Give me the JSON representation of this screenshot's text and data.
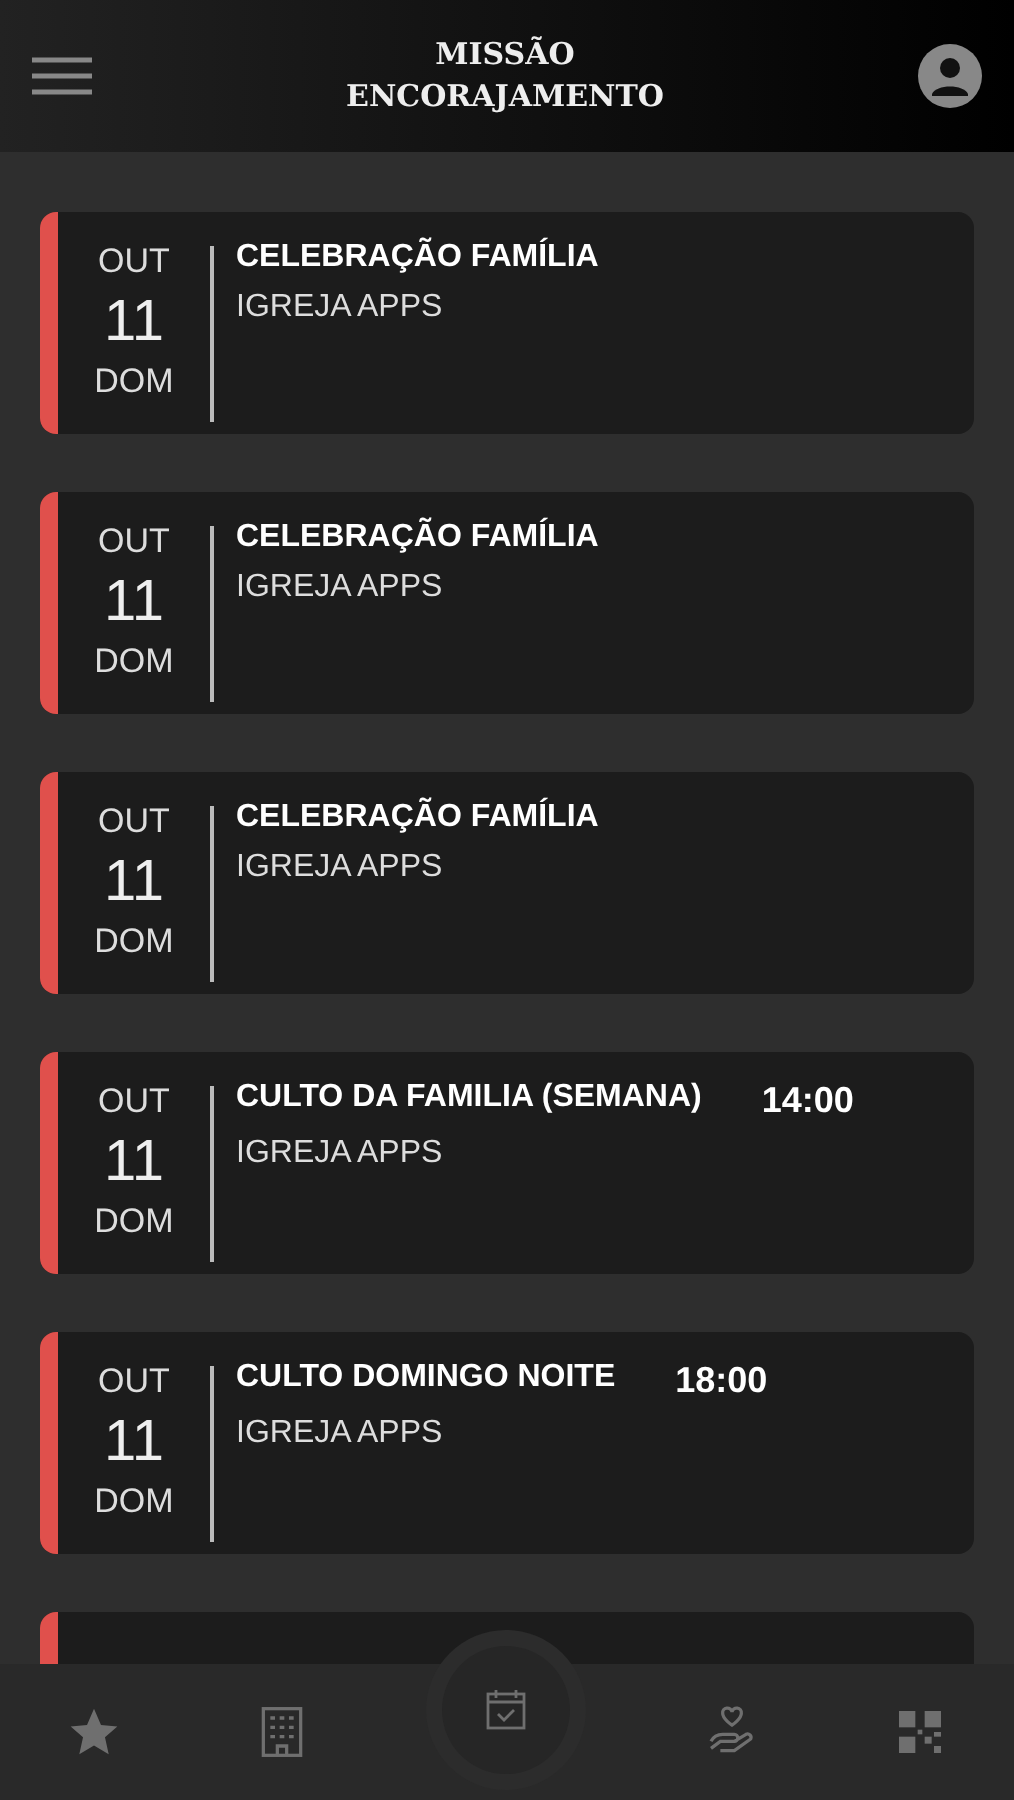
{
  "header": {
    "title_line_1": "MISSÃO",
    "title_line_2": "ENCORAJAMENTO"
  },
  "events": [
    {
      "month": "OUT",
      "day": "11",
      "weekday": "DOM",
      "title": "CELEBRAÇÃO FAMÍLIA",
      "organizer": "IGREJA APPS",
      "color": "#e0504c"
    },
    {
      "month": "OUT",
      "day": "11",
      "weekday": "DOM",
      "title": "CELEBRAÇÃO FAMÍLIA",
      "organizer": "IGREJA APPS",
      "color": "#e0504c"
    },
    {
      "month": "OUT",
      "day": "11",
      "weekday": "DOM",
      "title": "CELEBRAÇÃO FAMÍLIA",
      "organizer": "IGREJA APPS",
      "color": "#e0504c"
    },
    {
      "month": "OUT",
      "day": "11",
      "weekday": "DOM",
      "title": "CULTO DA FAMILIA (SEMANA)",
      "time": "14:00",
      "organizer": "IGREJA APPS",
      "color": "#e0504c"
    },
    {
      "month": "OUT",
      "day": "11",
      "weekday": "DOM",
      "title": "CULTO DOMINGO NOITE",
      "time": "18:00",
      "organizer": "IGREJA APPS",
      "color": "#e0504c"
    },
    {
      "color": "#e0504c"
    }
  ],
  "bottom_nav": [
    {
      "kind": "star",
      "selected": false
    },
    {
      "kind": "building",
      "selected": false
    },
    {
      "kind": "calendar",
      "selected": true
    },
    {
      "kind": "donate",
      "selected": false
    },
    {
      "kind": "qr",
      "selected": false
    }
  ]
}
